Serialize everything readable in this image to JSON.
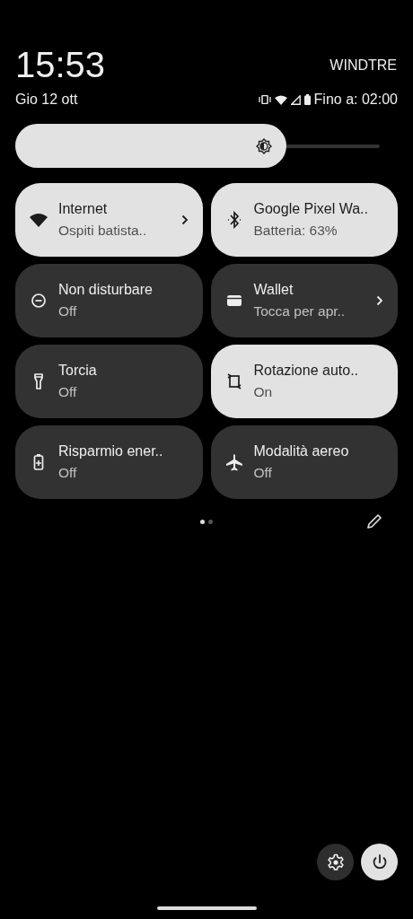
{
  "header": {
    "time": "15:53",
    "carrier": "WINDTRE",
    "date": "Gio 12 ott",
    "alarm": "Fino a: 02:00"
  },
  "brightness": {
    "level": 0.71
  },
  "tiles": [
    {
      "kind": "wifi",
      "title": "Internet",
      "subtitle": "Ospiti batista..",
      "on": true,
      "chevron": true
    },
    {
      "kind": "bluetooth",
      "title": "Google Pixel Wa..",
      "subtitle": "Batteria: 63%",
      "on": true,
      "chevron": false
    },
    {
      "kind": "dnd",
      "title": "Non disturbare",
      "subtitle": "Off",
      "on": false,
      "chevron": false
    },
    {
      "kind": "wallet",
      "title": "Wallet",
      "subtitle": "Tocca per apr..",
      "on": false,
      "chevron": true
    },
    {
      "kind": "torch",
      "title": "Torcia",
      "subtitle": "Off",
      "on": false,
      "chevron": false
    },
    {
      "kind": "rotate",
      "title": "Rotazione auto..",
      "subtitle": "On",
      "on": true,
      "chevron": false
    },
    {
      "kind": "battery",
      "title": "Risparmio ener..",
      "subtitle": "Off",
      "on": false,
      "chevron": false
    },
    {
      "kind": "plane",
      "title": "Modalità aereo",
      "subtitle": "Off",
      "on": false,
      "chevron": false
    }
  ],
  "pages": [
    {
      "selected": true
    },
    {
      "selected": false
    }
  ]
}
